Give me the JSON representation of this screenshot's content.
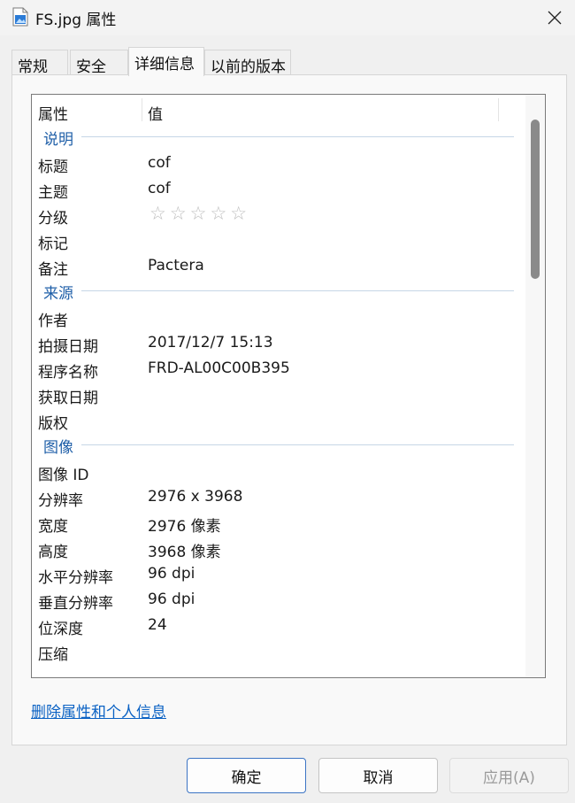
{
  "window": {
    "title": "FS.jpg 属性",
    "close_glyph": "✕"
  },
  "tabs": [
    {
      "label": "常规",
      "active": false
    },
    {
      "label": "安全",
      "active": false
    },
    {
      "label": "详细信息",
      "active": true
    },
    {
      "label": "以前的版本",
      "active": false
    }
  ],
  "list": {
    "col_property": "属性",
    "col_value": "值",
    "rows": [
      {
        "type": "group",
        "label": "说明"
      },
      {
        "type": "item",
        "name": "标题",
        "value": "cof"
      },
      {
        "type": "item",
        "name": "主题",
        "value": "cof"
      },
      {
        "type": "rating",
        "name": "分级",
        "stars": "☆☆☆☆☆",
        "rating": 0
      },
      {
        "type": "item",
        "name": "标记",
        "value": ""
      },
      {
        "type": "item",
        "name": "备注",
        "value": "Pactera"
      },
      {
        "type": "group",
        "label": "来源"
      },
      {
        "type": "item",
        "name": "作者",
        "value": ""
      },
      {
        "type": "item",
        "name": "拍摄日期",
        "value": "2017/12/7 15:13"
      },
      {
        "type": "item",
        "name": "程序名称",
        "value": "FRD-AL00C00B395"
      },
      {
        "type": "item",
        "name": "获取日期",
        "value": ""
      },
      {
        "type": "item",
        "name": "版权",
        "value": ""
      },
      {
        "type": "group",
        "label": "图像"
      },
      {
        "type": "item",
        "name": "图像 ID",
        "value": ""
      },
      {
        "type": "item",
        "name": "分辨率",
        "value": "2976 x 3968"
      },
      {
        "type": "item",
        "name": "宽度",
        "value": "2976 像素"
      },
      {
        "type": "item",
        "name": "高度",
        "value": "3968 像素"
      },
      {
        "type": "item",
        "name": "水平分辨率",
        "value": "96 dpi"
      },
      {
        "type": "item",
        "name": "垂直分辨率",
        "value": "96 dpi"
      },
      {
        "type": "item",
        "name": "位深度",
        "value": "24"
      },
      {
        "type": "item",
        "name": "压缩",
        "value": ""
      }
    ]
  },
  "remove_link": "删除属性和个人信息",
  "buttons": {
    "ok": "确定",
    "cancel": "取消",
    "apply": "应用(A)"
  },
  "colors": {
    "group_label": "#1f5fa8",
    "link": "#0b62c4",
    "ok_border": "#3b74c4"
  }
}
